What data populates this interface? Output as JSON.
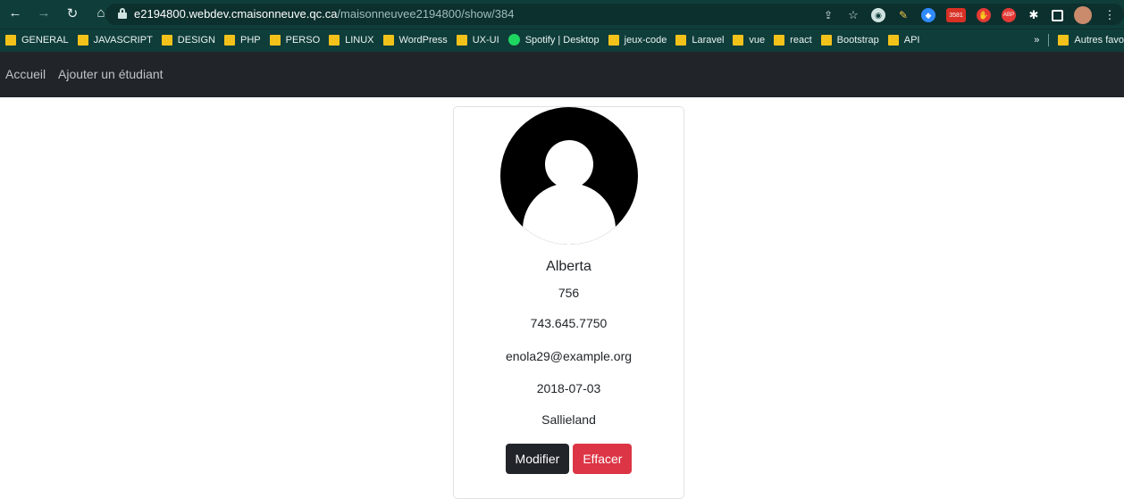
{
  "browser": {
    "url_host": "e2194800.webdev.cmaisonneuve.qc.ca",
    "url_path": "/maisonneuvee2194800/show/384",
    "badge_count": "3581"
  },
  "bookmarks": [
    {
      "label": "GENERAL",
      "icon": "folder-icon"
    },
    {
      "label": "JAVASCRIPT",
      "icon": "folder-icon"
    },
    {
      "label": "DESIGN",
      "icon": "folder-icon"
    },
    {
      "label": "PHP",
      "icon": "folder-icon"
    },
    {
      "label": "PERSO",
      "icon": "folder-icon"
    },
    {
      "label": "LINUX",
      "icon": "folder-icon"
    },
    {
      "label": "WordPress",
      "icon": "folder-icon"
    },
    {
      "label": "UX-UI",
      "icon": "folder-icon"
    },
    {
      "label": "Spotify | Desktop",
      "icon": "spotify-icon"
    },
    {
      "label": "jeux-code",
      "icon": "folder-icon"
    },
    {
      "label": "Laravel",
      "icon": "folder-icon"
    },
    {
      "label": "vue",
      "icon": "folder-icon"
    },
    {
      "label": "react",
      "icon": "folder-icon"
    },
    {
      "label": "Bootstrap",
      "icon": "folder-icon"
    },
    {
      "label": "API",
      "icon": "folder-icon"
    }
  ],
  "bookmarks_more": "»",
  "bookmarks_other": "Autres favo",
  "nav": {
    "home": "Accueil",
    "add_student": "Ajouter un étudiant"
  },
  "student": {
    "name": "Alberta",
    "number": "756",
    "phone": "743.645.7750",
    "email": "enola29@example.org",
    "date": "2018-07-03",
    "city": "Sallieland"
  },
  "actions": {
    "edit": "Modifier",
    "delete": "Effacer"
  },
  "colors": {
    "browser_bg": "#0f3d3a",
    "navbar_bg": "#212529",
    "btn_dark": "#212529",
    "btn_danger": "#dc3545",
    "folder": "#f2c21b"
  }
}
